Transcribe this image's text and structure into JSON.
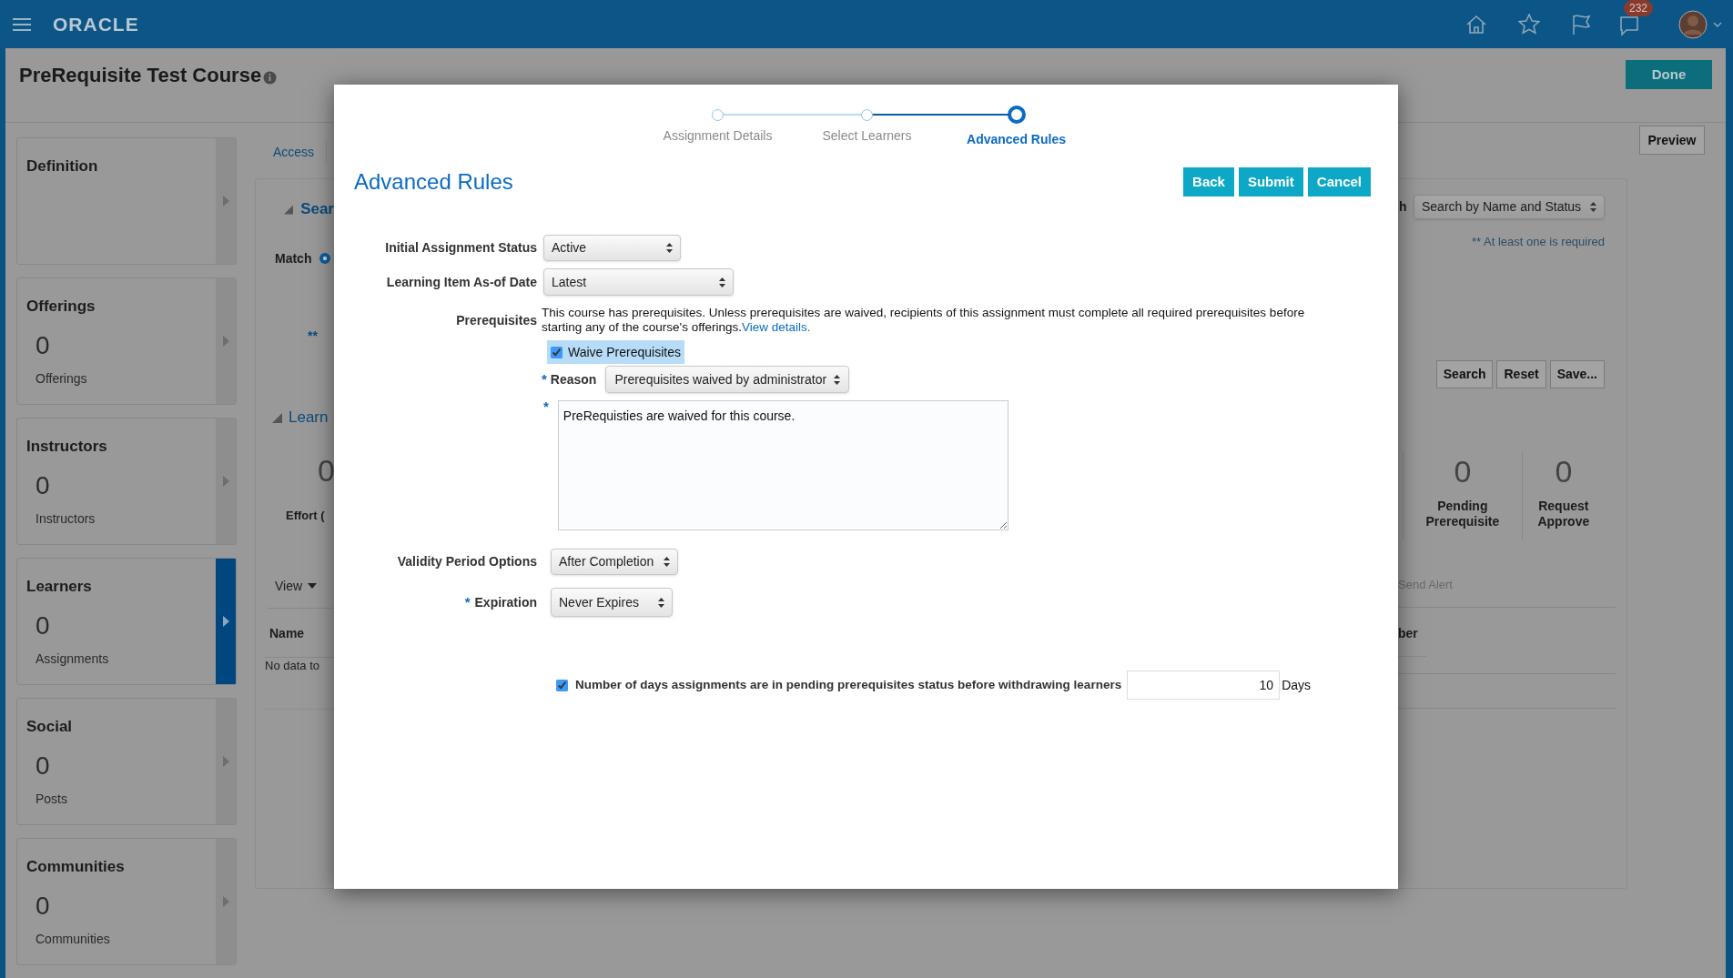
{
  "header": {
    "logo": "ORACLE",
    "notification_count": "232"
  },
  "page": {
    "title": "PreRequisite Test Course",
    "done_button": "Done",
    "tab": "Access",
    "preview_button": "Preview"
  },
  "sidebar": [
    {
      "title": "Definition",
      "selected": false
    },
    {
      "title": "Offerings",
      "count": "0",
      "caption": "Offerings",
      "selected": false
    },
    {
      "title": "Instructors",
      "count": "0",
      "caption": "Instructors",
      "selected": false
    },
    {
      "title": "Learners",
      "count": "0",
      "caption": "Assignments",
      "selected": true
    },
    {
      "title": "Social",
      "count": "0",
      "caption": "Posts",
      "selected": false
    },
    {
      "title": "Communities",
      "count": "0",
      "caption": "Communities",
      "selected": false
    }
  ],
  "background_left": {
    "search_section": "Sear",
    "match_label": "Match",
    "match_selected": true,
    "required_mark": "**",
    "learners_section": "Learn",
    "count": "0",
    "effort_label": "Effort (",
    "view_menu": "View",
    "name_column": "Name",
    "empty_message": "No data to"
  },
  "background_right": {
    "search_label_end": "h",
    "search_select": "Search by Name and Status",
    "required_note": "** At least one is required",
    "buttons": [
      "Search",
      "Reset",
      "Save..."
    ],
    "stats": [
      {
        "value": "0",
        "label": "Pending Prerequisite"
      },
      {
        "value": "0",
        "label": "Request Approve"
      }
    ],
    "send_alert": "Send Alert",
    "column_end": "ber"
  },
  "dialog": {
    "steps": [
      {
        "label": "Assignment Details",
        "selected": false
      },
      {
        "label": "Select Learners",
        "selected": false
      },
      {
        "label": "Advanced Rules",
        "selected": true
      }
    ],
    "title": "Advanced Rules",
    "buttons": [
      "Back",
      "Submit",
      "Cancel"
    ],
    "initial_status": {
      "label": "Initial Assignment Status",
      "value": "Active"
    },
    "as_of_date": {
      "label": "Learning Item As-of Date",
      "value": "Latest"
    },
    "prerequisites": {
      "label": "Prerequisites",
      "text": "This course has prerequisites. Unless prerequisites are waived, recipients of this assignment must complete all required prerequisites before starting any of the course's offerings.",
      "link": "View details."
    },
    "waive": {
      "label": "Waive Prerequisites",
      "checked": true
    },
    "reason": {
      "marker": "*",
      "label": "Reason",
      "value": "Prerequisites waived by administrator"
    },
    "comment": {
      "marker": "*",
      "value": "PreRequisties are waived for this course."
    },
    "validity": {
      "label": "Validity Period Options",
      "value": "After Completion"
    },
    "expiration": {
      "marker": "*",
      "label": "Expiration",
      "value": "Never Expires"
    },
    "withdraw": {
      "label": "Number of days assignments are in pending prerequisites status before withdrawing learners",
      "checked": true,
      "value": "10",
      "unit": "Days"
    }
  }
}
